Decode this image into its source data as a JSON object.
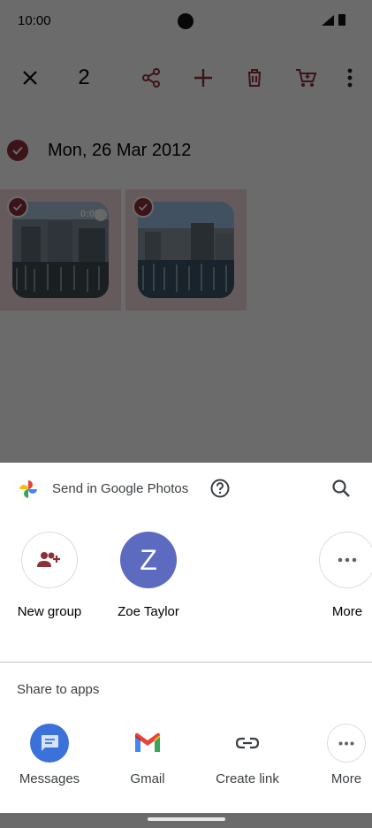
{
  "status": {
    "time": "10:00"
  },
  "toolbar": {
    "selected_count": "2"
  },
  "photos": {
    "date_label": "Mon, 26 Mar 2012",
    "items": [
      {
        "duration": "0:05"
      },
      {
        "duration": ""
      }
    ]
  },
  "sheet": {
    "send_label": "Send in Google Photos",
    "contacts": [
      {
        "label": "New group"
      },
      {
        "label": "Zoe Taylor",
        "initial": "Z"
      },
      {
        "label": "More"
      }
    ],
    "share_title": "Share to apps",
    "apps": [
      {
        "label": "Messages"
      },
      {
        "label": "Gmail"
      },
      {
        "label": "Create link"
      },
      {
        "label": "More"
      }
    ]
  },
  "colors": {
    "accent": "#8c2f39",
    "avatar": "#5c6bc0",
    "messages": "#3b72d9"
  }
}
